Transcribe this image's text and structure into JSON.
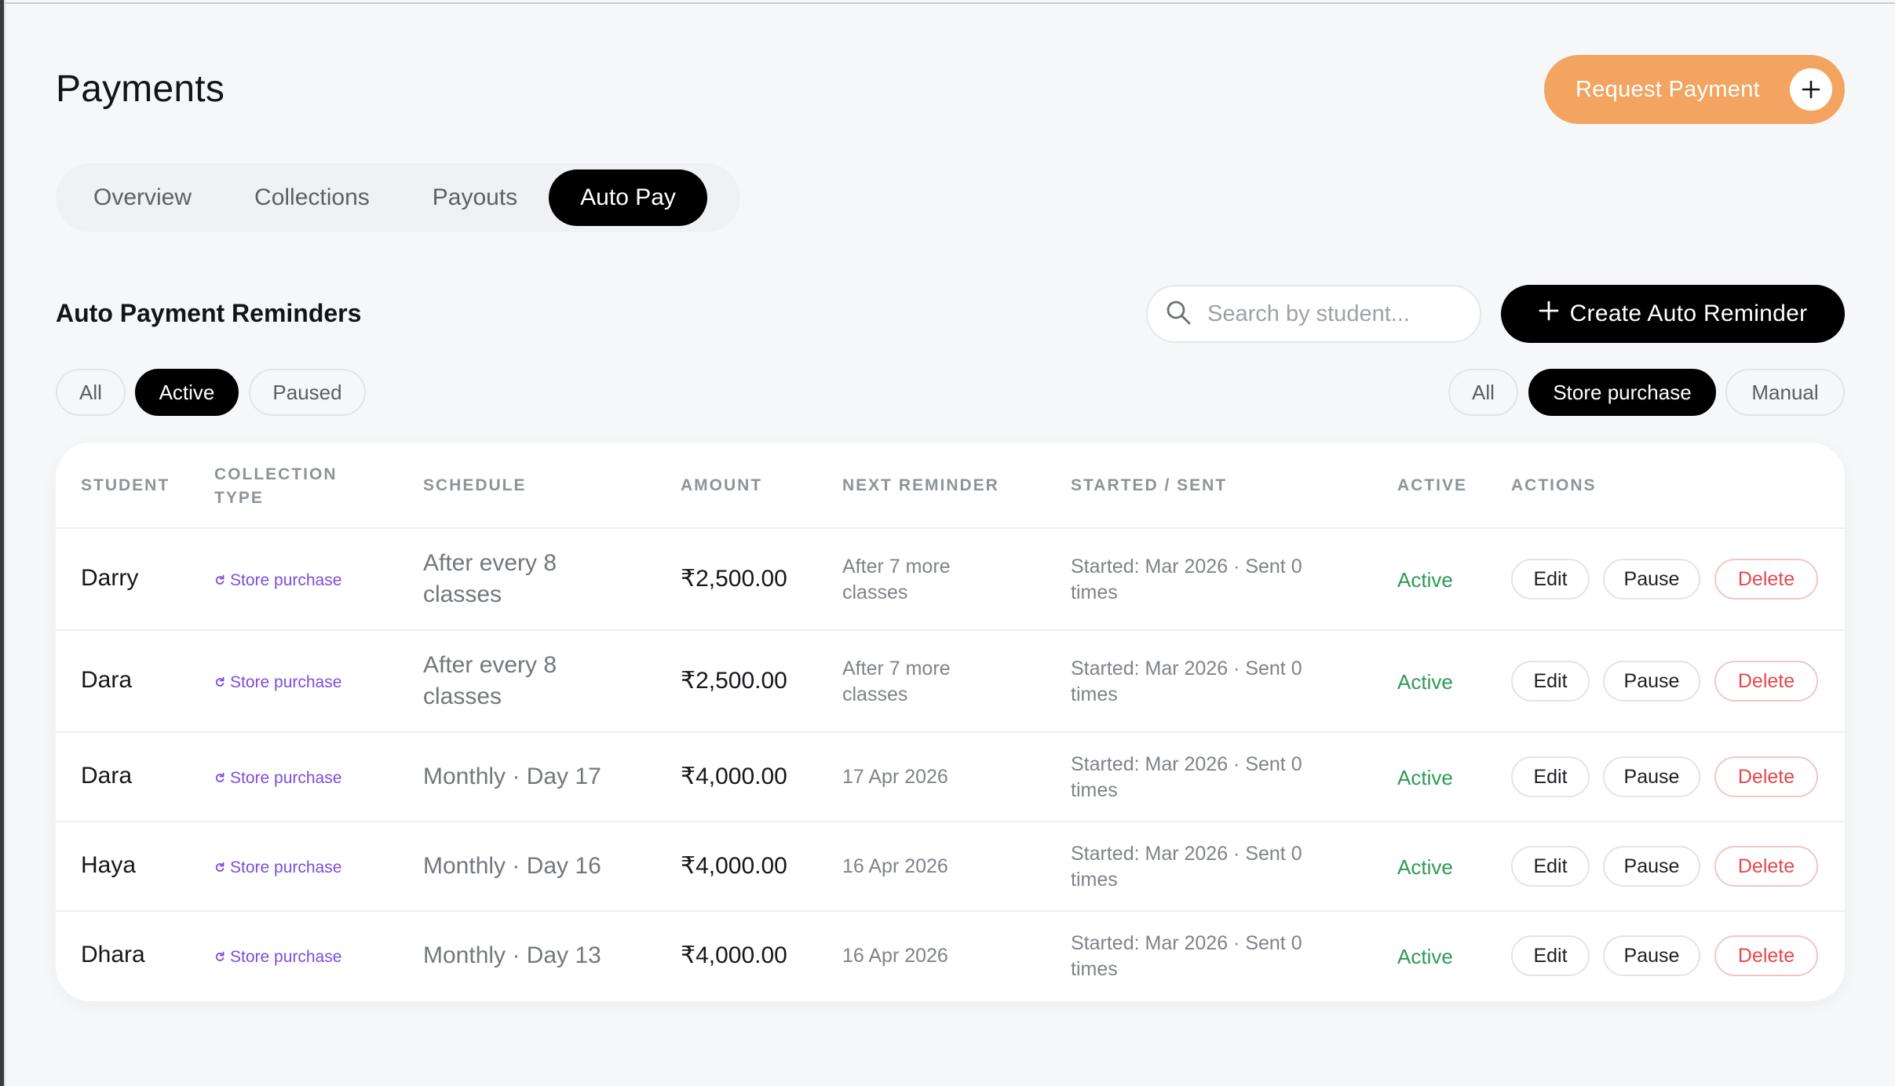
{
  "page": {
    "title": "Payments",
    "request_button": "Request Payment"
  },
  "tabs": [
    {
      "label": "Overview",
      "active": false
    },
    {
      "label": "Collections",
      "active": false
    },
    {
      "label": "Payouts",
      "active": false
    },
    {
      "label": "Auto Pay",
      "active": true
    }
  ],
  "section": {
    "title": "Auto Payment Reminders",
    "search_placeholder": "Search by student...",
    "create_button": "Create Auto Reminder"
  },
  "status_filters": [
    {
      "label": "All",
      "active": false
    },
    {
      "label": "Active",
      "active": true
    },
    {
      "label": "Paused",
      "active": false
    }
  ],
  "type_filters": [
    {
      "label": "All",
      "active": false
    },
    {
      "label": "Store purchase",
      "active": true
    },
    {
      "label": "Manual",
      "active": false
    }
  ],
  "table": {
    "headers": {
      "student": "Student",
      "collection_type": "Collection Type",
      "schedule": "Schedule",
      "amount": "Amount",
      "next_reminder": "Next Reminder",
      "started_sent": "Started / Sent",
      "active": "Active",
      "actions": "Actions"
    },
    "action_labels": {
      "edit": "Edit",
      "pause": "Pause",
      "delete": "Delete"
    },
    "rows": [
      {
        "student": "Darry",
        "collection_type": "Store purchase",
        "schedule": "After every 8 classes",
        "amount": "₹2,500.00",
        "next_reminder": "After 7 more classes",
        "started_sent": "Started: Mar 2026 · Sent 0 times",
        "status": "Active"
      },
      {
        "student": "Dara",
        "collection_type": "Store purchase",
        "schedule": "After every 8 classes",
        "amount": "₹2,500.00",
        "next_reminder": "After 7 more classes",
        "started_sent": "Started: Mar 2026 · Sent 0 times",
        "status": "Active"
      },
      {
        "student": "Dara",
        "collection_type": "Store purchase",
        "schedule": "Monthly · Day 17",
        "amount": "₹4,000.00",
        "next_reminder": "17 Apr 2026",
        "started_sent": "Started: Mar 2026 · Sent 0 times",
        "status": "Active"
      },
      {
        "student": "Haya",
        "collection_type": "Store purchase",
        "schedule": "Monthly · Day 16",
        "amount": "₹4,000.00",
        "next_reminder": "16 Apr 2026",
        "started_sent": "Started: Mar 2026 · Sent 0 times",
        "status": "Active"
      },
      {
        "student": "Dhara",
        "collection_type": "Store purchase",
        "schedule": "Monthly · Day 13",
        "amount": "₹4,000.00",
        "next_reminder": "16 Apr 2026",
        "started_sent": "Started: Mar 2026 · Sent 0 times",
        "status": "Active"
      }
    ]
  },
  "icons": {
    "request": "plus-icon",
    "search": "search-icon",
    "create": "plus-icon",
    "collection_type": "refresh-icon"
  },
  "colors": {
    "accent_orange": "#f2a460",
    "active_green": "#2f9a55",
    "store_purple": "#7c4ddb",
    "delete_red": "#e5484d"
  }
}
